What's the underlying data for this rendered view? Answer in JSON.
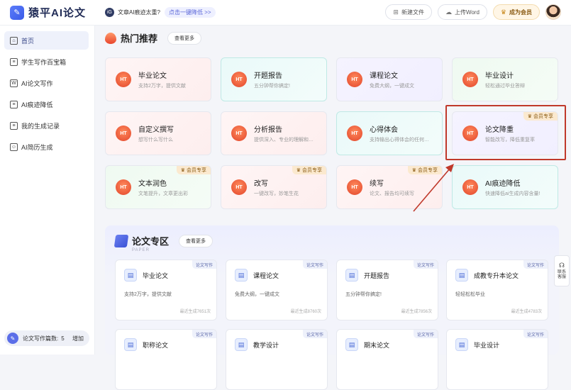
{
  "app": {
    "logo_text": "猿平AI论文",
    "logo_mark": "✎"
  },
  "notice": {
    "icon": "iG",
    "text": "文章AI痕迹太重?",
    "link": "点击一键降低 >>"
  },
  "top_actions": {
    "new_file": "新建文件",
    "upload": "上传Word",
    "vip": "成为会员"
  },
  "sidebar": {
    "items": [
      {
        "label": "首页",
        "icon": "home-icon",
        "glyph": "⌂"
      },
      {
        "label": "学生写作百宝箱",
        "icon": "book-icon",
        "glyph": "≡"
      },
      {
        "label": "AI论文写作",
        "icon": "doc-write-icon",
        "glyph": "W"
      },
      {
        "label": "AI痕迹降低",
        "icon": "doc-reduce-icon",
        "glyph": "≡"
      },
      {
        "label": "我的生成记录",
        "icon": "history-icon",
        "glyph": "≡"
      },
      {
        "label": "AI简历生成",
        "icon": "resume-icon",
        "glyph": "☺"
      }
    ],
    "quota_label": "论文写作篇数:",
    "quota_value": "5",
    "quota_add": "增加"
  },
  "hot": {
    "title": "热门推荐",
    "more": "查看更多",
    "badge_text": "会员专享",
    "cards": [
      {
        "title": "毕业论文",
        "desc": "支持2万字，提供文献",
        "icon": "HT",
        "style": "pink",
        "badge": false
      },
      {
        "title": "开题报告",
        "desc": "五分钟帮你搞定!",
        "icon": "HT",
        "style": "teal",
        "badge": false
      },
      {
        "title": "课程论文",
        "desc": "免费大纲，一键成文",
        "icon": "HT",
        "style": "lav",
        "badge": false
      },
      {
        "title": "毕业设计",
        "desc": "轻松通过毕业答辩",
        "icon": "HT",
        "style": "green",
        "badge": false
      },
      {
        "title": "自定义撰写",
        "desc": "想写什么写什么",
        "icon": "HT",
        "style": "pink",
        "badge": false
      },
      {
        "title": "分析报告",
        "desc": "提供深入、专业的理解和…",
        "icon": "HT",
        "style": "pink",
        "badge": false
      },
      {
        "title": "心得体会",
        "desc": "支持输出心得体会的任何…",
        "icon": "HT",
        "style": "teal",
        "badge": false
      },
      {
        "title": "论文降重",
        "desc": "智能改写，降低重复率",
        "icon": "HT",
        "style": "lav",
        "badge": true
      },
      {
        "title": "文本润色",
        "desc": "文笔提升，文章更出彩",
        "icon": "HT",
        "style": "green",
        "badge": true
      },
      {
        "title": "改写",
        "desc": "一键改写，妙笔生花",
        "icon": "HT",
        "style": "pink",
        "badge": true
      },
      {
        "title": "续写",
        "desc": "论文、报告均可续写",
        "icon": "HT",
        "style": "pink",
        "badge": true
      },
      {
        "title": "AI痕迹降低",
        "desc": "快速降低ai生成内容含量!",
        "icon": "HT",
        "style": "teal",
        "badge": false
      }
    ]
  },
  "paper": {
    "title": "论文专区",
    "subtitle": "PAPER",
    "more": "查看更多",
    "cards": [
      {
        "title": "毕业论文",
        "desc": "支持2万字，提供文献",
        "tag": "论文写作",
        "count": "最近生成7651次"
      },
      {
        "title": "课程论文",
        "desc": "免费大纲，一键成文",
        "tag": "论文写作",
        "count": "最近生成8760次"
      },
      {
        "title": "开题报告",
        "desc": "五分钟帮你搞定!",
        "tag": "论文写作",
        "count": "最近生成7856次"
      },
      {
        "title": "成教专升本论文",
        "desc": "轻轻松松毕业",
        "tag": "论文写作",
        "count": "最近生成4783次"
      },
      {
        "title": "职称论文",
        "desc": "",
        "tag": "论文写作",
        "count": ""
      },
      {
        "title": "教学设计",
        "desc": "",
        "tag": "论文写作",
        "count": ""
      },
      {
        "title": "期末论文",
        "desc": "",
        "tag": "论文写作",
        "count": ""
      },
      {
        "title": "毕业设计",
        "desc": "",
        "tag": "论文写作",
        "count": ""
      }
    ]
  },
  "contact": {
    "line1": "联系",
    "line2": "客服"
  },
  "colors": {
    "accent": "#5b6ee8",
    "highlight": "#c0392b",
    "vip": "#fbe9cf"
  }
}
